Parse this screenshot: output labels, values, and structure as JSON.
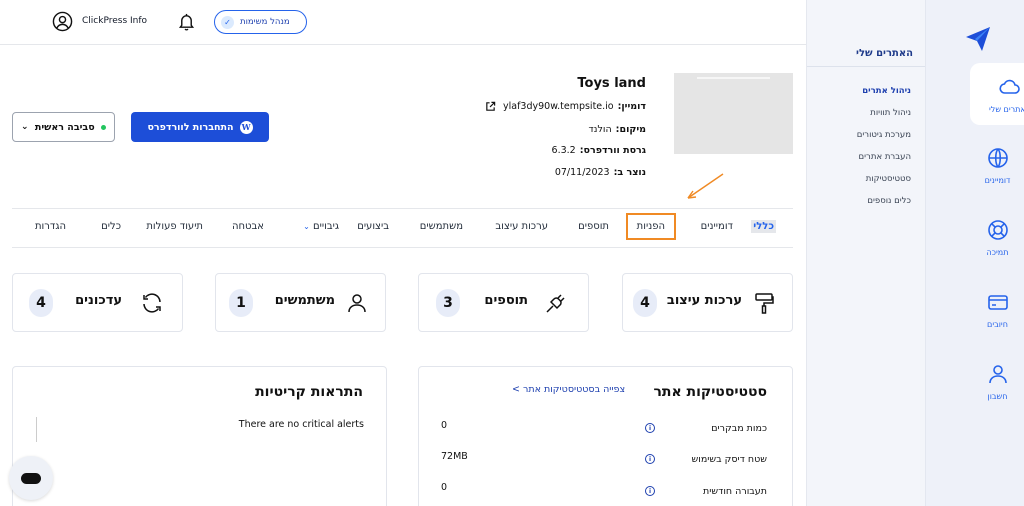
{
  "topbar": {
    "user_name": "ClickPress Info",
    "tasks_label": "מנהל משימות"
  },
  "site": {
    "name": "Toys land",
    "domain_label": "דומיין:",
    "domain_value": "ylaf3dy90w.tempsite.io",
    "location_label": "מיקום:",
    "location_value": "הולנד",
    "wp_version_label": "גרסת וורדפרס:",
    "wp_version_value": "6.3.2",
    "created_label": "נוצר ב:",
    "created_value": "07/11/2023",
    "wp_login_label": "התחברות לוורדפרס",
    "environment_label": "סביבה ראשית"
  },
  "tabs": [
    "כללי",
    "דומיינים",
    "הפניות",
    "תוספים",
    "ערכות עיצוב",
    "משתמשים",
    "ביצועים",
    "גיבויים",
    "אבטחה",
    "תיעוד פעולות",
    "כלים",
    "הגדרות"
  ],
  "stats": {
    "themes": {
      "label": "ערכות עיצוב",
      "count": "4"
    },
    "plugins": {
      "label": "תוספים",
      "count": "3"
    },
    "users": {
      "label": "משתמשים",
      "count": "1"
    },
    "updates": {
      "label": "עדכונים",
      "count": "4"
    }
  },
  "site_stats": {
    "title": "סטטיסטיקות אתר",
    "view_link": "צפייה בסטטיסטיקות אתר >",
    "rows": [
      {
        "label": "כמות מבקרים",
        "value": "0"
      },
      {
        "label": "שטח דיסק בשימוש",
        "value": "72MB"
      },
      {
        "label": "תעבורה חודשית",
        "value": "0"
      }
    ]
  },
  "alerts": {
    "title": "התראות קריטיות",
    "empty": "There are no critical alerts"
  },
  "subnav": {
    "title": "האתרים שלי",
    "items": [
      "ניהול אתרים",
      "ניהול תוויות",
      "מערכת גיטורים",
      "העברת אתרים",
      "סטטיסטיקות",
      "כלים נוספים"
    ]
  },
  "rail": {
    "items": [
      "האתרים שלי",
      "דומיינים",
      "תמיכה",
      "חיובים",
      "חשבון"
    ]
  },
  "colors": {
    "accent": "#1d4ed8",
    "highlight_border": "#f08a24"
  }
}
